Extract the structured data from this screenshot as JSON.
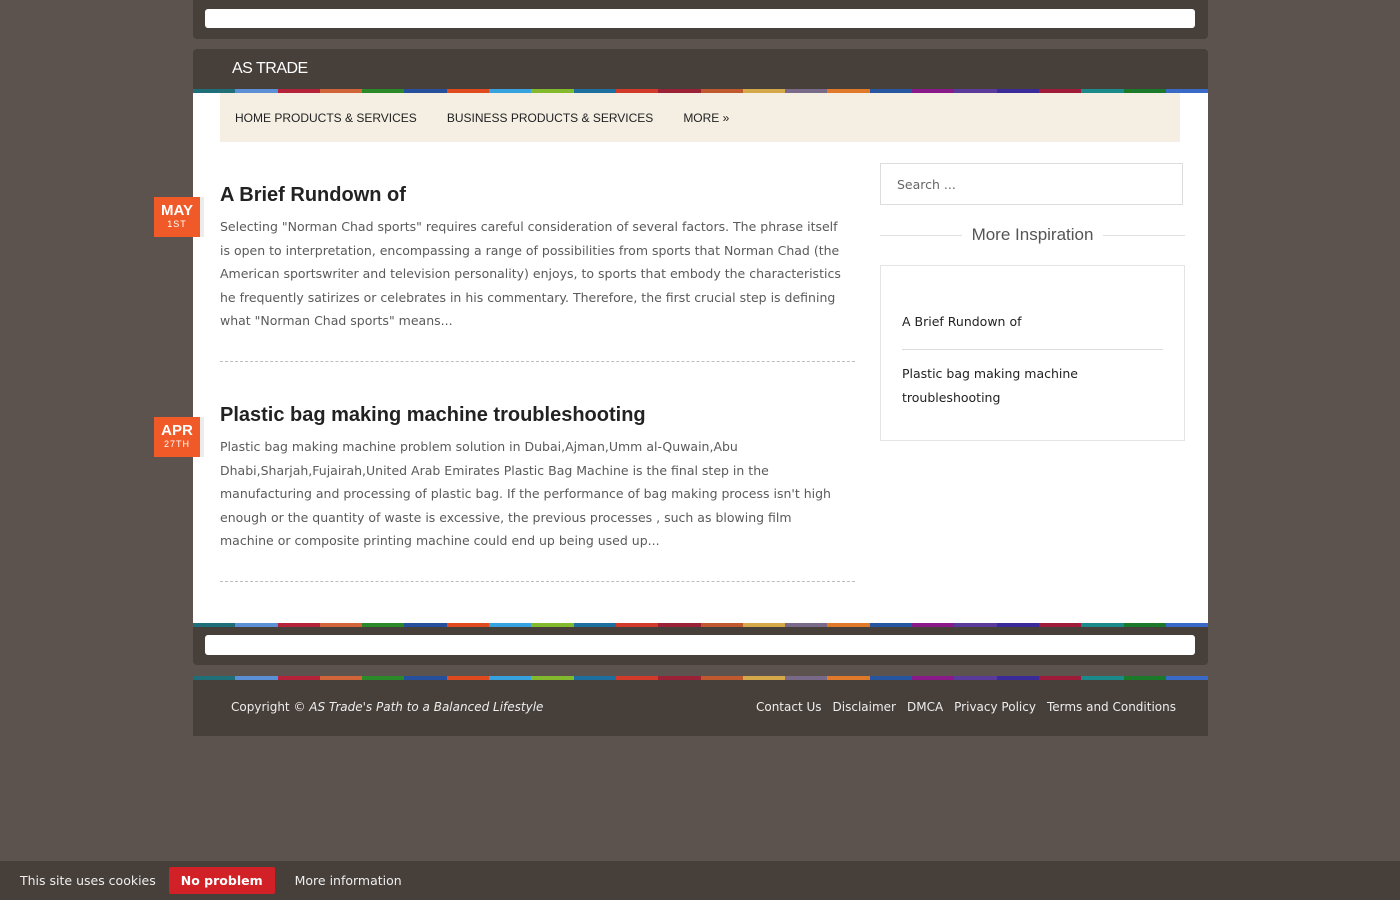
{
  "site": {
    "title": "AS TRADE"
  },
  "nav": {
    "items": [
      {
        "label": "HOME PRODUCTS & SERVICES"
      },
      {
        "label": "BUSINESS PRODUCTS & SERVICES"
      },
      {
        "label": "MORE »"
      }
    ]
  },
  "posts": [
    {
      "date_month": "MAY",
      "date_day": "1ST",
      "title": "A Brief Rundown of",
      "excerpt": "Selecting \"Norman Chad sports\" requires careful consideration of several factors. The phrase itself is open to interpretation, encompassing a range of possibilities from sports that Norman Chad (the American sportswriter and television personality) enjoys, to sports that embody the characteristics he frequently satirizes or celebrates in his commentary. Therefore, the first crucial step is defining what \"Norman Chad sports\" means..."
    },
    {
      "date_month": "APR",
      "date_day": "27TH",
      "title": "Plastic bag making machine troubleshooting",
      "excerpt": "Plastic bag making machine problem solution in Dubai,Ajman,Umm al-Quwain,Abu Dhabi,Sharjah,Fujairah,United Arab Emirates Plastic Bag Machine is the final step in the manufacturing and processing of plastic bag. If the performance of bag making process isn't high enough or the quantity of waste is excessive, the previous processes , such as blowing film machine or composite printing machine could end up being used up..."
    }
  ],
  "sidebar": {
    "search_placeholder": "Search ...",
    "widget_title": "More Inspiration",
    "links": [
      {
        "label": "A Brief Rundown of"
      },
      {
        "label": "Plastic bag making machine troubleshooting"
      }
    ]
  },
  "footer": {
    "copyright_prefix": "Copyright ©",
    "copyright_site": "AS Trade's Path to a Balanced Lifestyle",
    "links": [
      {
        "label": "Contact Us"
      },
      {
        "label": "Disclaimer"
      },
      {
        "label": "DMCA"
      },
      {
        "label": "Privacy Policy"
      },
      {
        "label": "Terms and Conditions"
      }
    ]
  },
  "cookie": {
    "text": "This site uses cookies",
    "accept_label": "No problem",
    "more_label": "More information"
  },
  "colors": {
    "background": "#5c534e",
    "header": "#473f3a",
    "nav_bg": "#f5efe3",
    "date_badge": "#f05a28",
    "cookie_button": "#d22027",
    "stripe": [
      "#1f6f78",
      "#5b8fd6",
      "#b5233a",
      "#d2643a",
      "#2a8a2a",
      "#264f9c",
      "#e04a1f",
      "#36a2e0",
      "#83b92d",
      "#1d6fa0",
      "#d23a2a",
      "#9b2136",
      "#c05a2e",
      "#d5a84a",
      "#7a6a8a",
      "#e07a2a",
      "#2656a0",
      "#8a1a8a",
      "#5a3a9a",
      "#3a2a9a",
      "#a01a3a",
      "#1a8a8a",
      "#1a7a2a",
      "#3a6ac8"
    ]
  }
}
